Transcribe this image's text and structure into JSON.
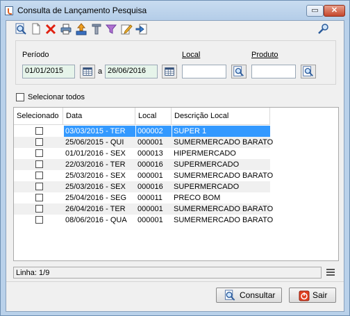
{
  "window": {
    "title": "Consulta de Lançamento Pesquisa",
    "restore_glyph": "▭",
    "close_glyph": "✕"
  },
  "toolbar": {
    "icons": [
      "search-doc-icon",
      "new-doc-icon",
      "delete-icon",
      "print-icon",
      "export-icon",
      "tools-icon",
      "filter-icon",
      "edit-icon",
      "import-icon",
      "key-search-icon"
    ]
  },
  "filters": {
    "periodo_label": "Período",
    "data_inicio": "01/01/2015",
    "separator": "a",
    "data_fim": "26/06/2016",
    "local_label": "Local",
    "local_value": "",
    "produto_label": "Produto",
    "produto_value": ""
  },
  "select_all_label": "Selecionar todos",
  "grid": {
    "columns": [
      "Selecionado",
      "Data",
      "Local",
      "Descrição Local"
    ],
    "rows": [
      {
        "data": "03/03/2015 - TER",
        "local": "000002",
        "descricao": "SUPER 1",
        "selected": true
      },
      {
        "data": "25/06/2015 - QUI",
        "local": "000001",
        "descricao": "SUMERMERCADO BARATO",
        "selected": false
      },
      {
        "data": "01/01/2016 - SEX",
        "local": "000013",
        "descricao": "HIPERMERCADO",
        "selected": false
      },
      {
        "data": "22/03/2016 - TER",
        "local": "000016",
        "descricao": "SUPERMERCADO",
        "selected": false
      },
      {
        "data": "25/03/2016 - SEX",
        "local": "000001",
        "descricao": "SUMERMERCADO BARATO",
        "selected": false
      },
      {
        "data": "25/03/2016 - SEX",
        "local": "000016",
        "descricao": "SUPERMERCADO",
        "selected": false
      },
      {
        "data": "25/04/2016 - SEG",
        "local": "000011",
        "descricao": "PRECO BOM",
        "selected": false
      },
      {
        "data": "26/04/2016 - TER",
        "local": "000001",
        "descricao": "SUMERMERCADO BARATO",
        "selected": false
      },
      {
        "data": "08/06/2016 - QUA",
        "local": "000001",
        "descricao": "SUMERMERCADO BARATO",
        "selected": false
      }
    ]
  },
  "status": {
    "linha": "Linha: 1/9"
  },
  "buttons": {
    "consultar": "Consultar",
    "sair": "Sair"
  },
  "colors": {
    "selection": "#3399ff",
    "stripe": "#f0f0f0",
    "title_bar": "#c8dcf0"
  }
}
